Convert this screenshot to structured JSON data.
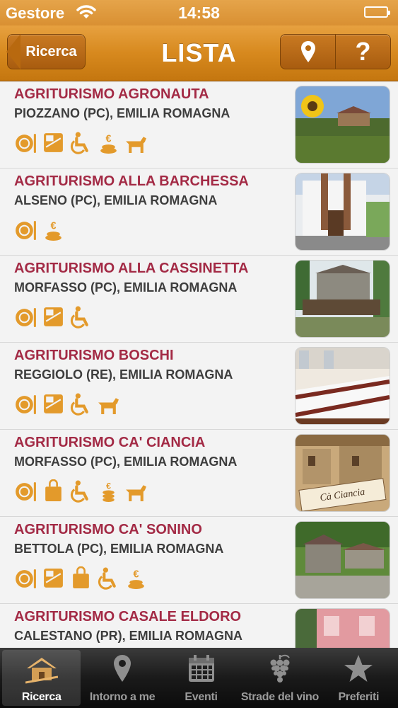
{
  "status_bar": {
    "carrier": "Gestore",
    "time": "14:58"
  },
  "nav": {
    "back_label": "Ricerca",
    "title": "LISTA",
    "map_icon": "location-pin-icon",
    "help_label": "?"
  },
  "colors": {
    "accent": "#d7891e",
    "name_text": "#a32a45",
    "icon_orange": "#e39a2b"
  },
  "items": [
    {
      "name": "AGRITURISMO AGRONAUTA",
      "location": "PIOZZANO (PC), EMILIA ROMAGNA",
      "services": [
        "restaurant-icon",
        "lodging-icon",
        "wheelchair-icon",
        "price-icon",
        "pets-icon"
      ]
    },
    {
      "name": "AGRITURISMO ALLA BARCHESSA",
      "location": "ALSENO (PC), EMILIA ROMAGNA",
      "services": [
        "restaurant-icon",
        "price-icon"
      ]
    },
    {
      "name": "AGRITURISMO ALLA CASSINETTA",
      "location": "MORFASSO (PC), EMILIA ROMAGNA",
      "services": [
        "restaurant-icon",
        "lodging-icon",
        "wheelchair-icon"
      ]
    },
    {
      "name": "AGRITURISMO BOSCHI",
      "location": "REGGIOLO (RE), EMILIA ROMAGNA",
      "services": [
        "restaurant-icon",
        "lodging-icon",
        "wheelchair-icon",
        "pets-icon"
      ]
    },
    {
      "name": "AGRITURISMO CA' CIANCIA",
      "location": "MORFASSO (PC), EMILIA ROMAGNA",
      "services": [
        "restaurant-icon",
        "shop-bag-icon",
        "wheelchair-icon",
        "price-icon",
        "pets-icon"
      ]
    },
    {
      "name": "AGRITURISMO CA' SONINO",
      "location": "BETTOLA (PC), EMILIA ROMAGNA",
      "services": [
        "restaurant-icon",
        "lodging-icon",
        "shop-bag-icon",
        "wheelchair-icon",
        "price-icon"
      ]
    },
    {
      "name": "AGRITURISMO CASALE ELDORO",
      "location": "CALESTANO (PR), EMILIA ROMAGNA",
      "services": []
    }
  ],
  "thumb_signs": {
    "ca_ciancia": "Cà Ciancia"
  },
  "tabs": [
    {
      "label": "Ricerca",
      "icon": "farmhouse-icon",
      "active": true
    },
    {
      "label": "Intorno a me",
      "icon": "location-pin-icon",
      "active": false
    },
    {
      "label": "Eventi",
      "icon": "calendar-icon",
      "active": false
    },
    {
      "label": "Strade del vino",
      "icon": "grapes-icon",
      "active": false
    },
    {
      "label": "Preferiti",
      "icon": "star-icon",
      "active": false
    }
  ]
}
